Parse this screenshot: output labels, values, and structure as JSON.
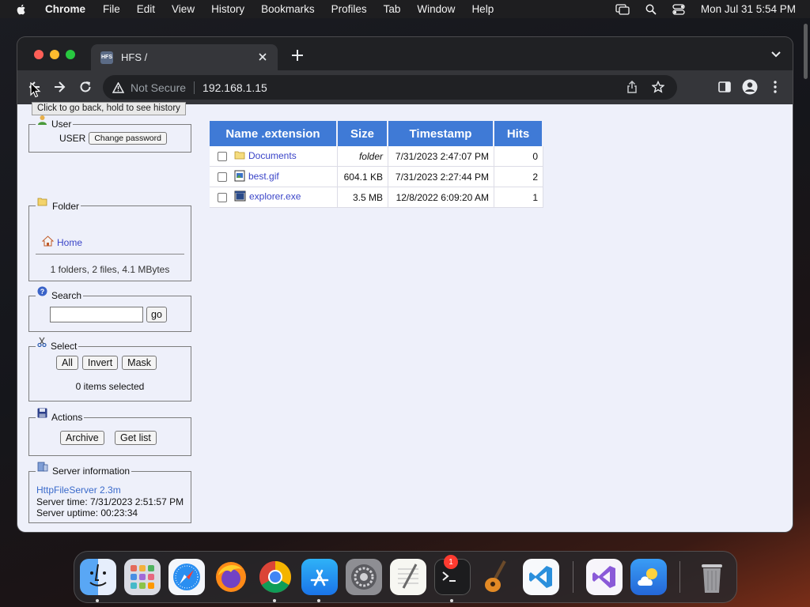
{
  "menubar": {
    "app_name": "Chrome",
    "items": [
      "File",
      "Edit",
      "View",
      "History",
      "Bookmarks",
      "Profiles",
      "Tab",
      "Window",
      "Help"
    ],
    "clock": "Mon Jul 31  5:54 PM"
  },
  "browser": {
    "tab_title": "HFS /",
    "tab_favicon_text": "HFS",
    "not_secure_label": "Not Secure",
    "url": "192.168.1.15",
    "tooltip": "Click to go back, hold to see history"
  },
  "page": {
    "user_panel": {
      "legend": "User",
      "username": "USER",
      "change_password_label": "Change password"
    },
    "folder_panel": {
      "legend": "Folder",
      "home_link": "Home",
      "summary": "1 folders, 2 files, 4.1 MBytes"
    },
    "search_panel": {
      "legend": "Search",
      "input_value": "",
      "go_label": "go"
    },
    "select_panel": {
      "legend": "Select",
      "all_label": "All",
      "invert_label": "Invert",
      "mask_label": "Mask",
      "status": "0 items selected"
    },
    "actions_panel": {
      "legend": "Actions",
      "archive_label": "Archive",
      "getlist_label": "Get list"
    },
    "server_panel": {
      "legend": "Server information",
      "version_link": "HttpFileServer 2.3m",
      "server_time": "Server time: 7/31/2023 2:51:57 PM",
      "server_uptime": "Server uptime: 00:23:34"
    },
    "table": {
      "headers": [
        "Name .extension",
        "Size",
        "Timestamp",
        "Hits"
      ],
      "rows": [
        {
          "icon": "folder-icon",
          "name": "Documents",
          "size": "folder",
          "timestamp": "7/31/2023 2:47:07 PM",
          "hits": "0"
        },
        {
          "icon": "image-file-icon",
          "name": "best.gif",
          "size": "604.1 KB",
          "timestamp": "7/31/2023 2:27:44 PM",
          "hits": "2"
        },
        {
          "icon": "exe-file-icon",
          "name": "explorer.exe",
          "size": "3.5 MB",
          "timestamp": "12/8/2022 6:09:20 AM",
          "hits": "1"
        }
      ]
    }
  },
  "dock": {
    "apps": [
      "finder-icon",
      "launchpad-icon",
      "safari-icon",
      "firefox-icon",
      "chrome-icon",
      "app-store-icon",
      "system-settings-icon",
      "textedit-icon",
      "terminal-icon",
      "garageband-icon",
      "vscode-icon",
      "visual-studio-icon",
      "weather-icon",
      "trash-icon"
    ],
    "settings_badge": "1"
  },
  "colors": {
    "accent_header": "#3f7ad6",
    "page_background": "#eef0fa",
    "link": "#3a44c8"
  }
}
